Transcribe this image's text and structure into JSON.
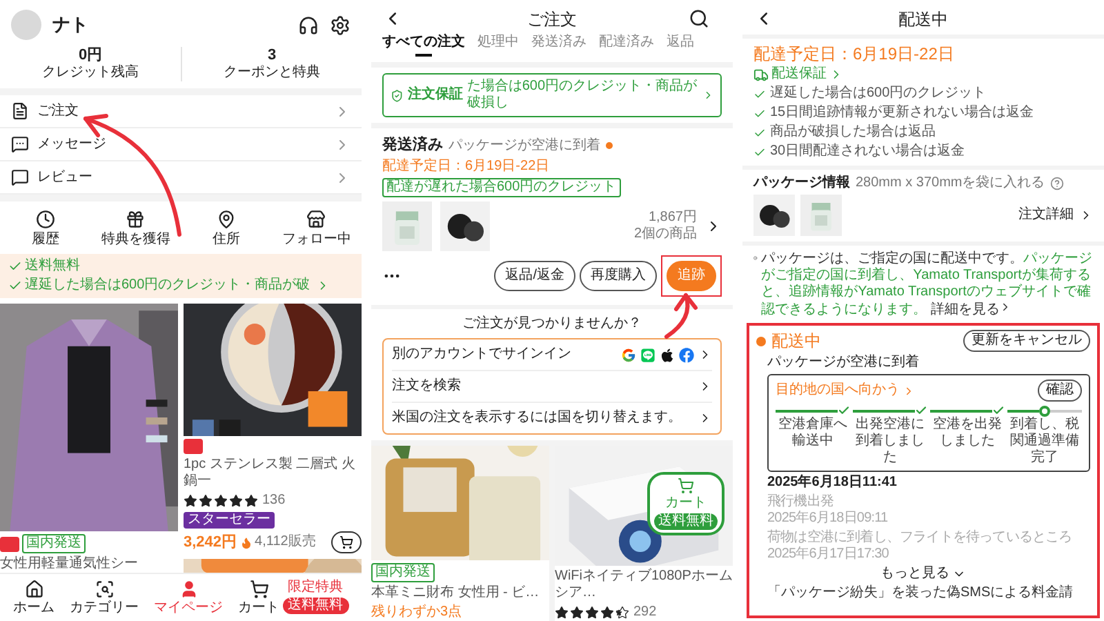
{
  "my_page": {
    "user": {
      "name": "ナト"
    },
    "annotation_arrow": true,
    "stats": [
      {
        "value": "0円",
        "label": "クレジット残高"
      },
      {
        "value": "3",
        "label": "クーポンと特典"
      }
    ],
    "menu": [
      {
        "kind": "orders",
        "label": "ご注文"
      },
      {
        "kind": "messages",
        "label": "メッセージ"
      },
      {
        "kind": "reviews",
        "label": "レビュー"
      }
    ],
    "shortcuts": [
      {
        "kind": "history",
        "label": "履歴"
      },
      {
        "kind": "rewards",
        "label": "特典を獲得"
      },
      {
        "kind": "address",
        "label": "住所"
      },
      {
        "kind": "following",
        "label": "フォロー中"
      }
    ],
    "banner": [
      "送料無料",
      "遅延した場合は600円のクレジット・商品が破"
    ],
    "product_columns": [
      [
        {
          "sale": true,
          "tags": [
            "国内発送"
          ],
          "title": "女性用軽量通気性シー"
        }
      ],
      [
        {
          "sale": true,
          "title": "1pc ステンレス製 二層式 火鍋一",
          "stars": 5,
          "reviews": "136",
          "badge": "スターセラー",
          "price": "3,242円",
          "sold": "4,112販売"
        },
        {
          "kind": "picture"
        }
      ]
    ],
    "nav": [
      {
        "kind": "home",
        "label": "ホーム",
        "selected": false
      },
      {
        "kind": "category",
        "label": "カテゴリー",
        "selected": false
      },
      {
        "kind": "account",
        "label": "マイページ",
        "selected": true
      },
      {
        "kind": "cart",
        "label": "カート",
        "selected": false,
        "badges": [
          {
            "kind": "text",
            "label": "限定特典"
          },
          {
            "kind": "pill",
            "label": "送料無料"
          }
        ]
      }
    ]
  },
  "orders_page": {
    "title": "ご注文",
    "annotation_arrow": true,
    "tabs": [
      {
        "label": "すべての注文",
        "selected": true
      },
      {
        "label": "処理中",
        "selected": false
      },
      {
        "label": "発送済み",
        "selected": false
      },
      {
        "label": "配達済み",
        "selected": false
      },
      {
        "label": "返品",
        "selected": false
      }
    ],
    "guarantee": {
      "label": "注文保証",
      "text": "た場合は600円のクレジット・商品が破損し"
    },
    "order": {
      "status": "発送済み",
      "detail": "パッケージが空港に到着",
      "delivery": "配達予定日：6月19日-22日",
      "tag": "配達が遅れた場合600円のクレジット",
      "total": "1,867円",
      "count": "2個の商品",
      "actions": [
        {
          "kind": "outline",
          "label": "返品/返金",
          "highlighted": false
        },
        {
          "kind": "outline",
          "label": "再度購入",
          "highlighted": false
        },
        {
          "kind": "primary",
          "label": "追跡",
          "highlighted": true
        }
      ]
    },
    "help": {
      "title": "ご注文が見つかりませんか？",
      "links": [
        {
          "kind": "sign_in",
          "label": "別のアカウントでサインイン"
        },
        {
          "kind": "plain",
          "label": "注文を検索"
        },
        {
          "kind": "plain",
          "label": "米国の注文を表示するには国を切り替えます。"
        }
      ]
    },
    "products": [
      {
        "tags": [
          "国内発送"
        ],
        "title": "本革ミニ財布 女性用 - ビ…",
        "note": "残りわずか3点"
      },
      {
        "title": "WiFiネイティブ1080Pホームシア…",
        "stars": 4.5,
        "reviews": "292",
        "cart_badge": {
          "label": "カート",
          "sub": "送料無料"
        }
      }
    ]
  },
  "tracking_page": {
    "title": "配送中",
    "delivery": "配達予定日：6月19日-22日",
    "guarantee": "配送保証",
    "promises": [
      "遅延した場合は600円のクレジット",
      "15日間追跡情報が更新されない場合は返金",
      "商品が破損した場合は返品",
      "30日間配達されない場合は返金"
    ],
    "package": {
      "label": "パッケージ情報",
      "size": "280mm x 370mmを袋に入れる",
      "details": "注文詳細"
    },
    "notice": {
      "parts": [
        {
          "kind": "plain",
          "text": "パッケージは、ご指定の国に配送中です。"
        },
        {
          "kind": "highlight",
          "text": "パッケージがご指定の国に到着し、Yamato Transportが集荷すると、追跡情報がYamato Transportのウェブサイトで確認できるようになります。"
        }
      ],
      "link": "詳細を見る"
    },
    "timeline": {
      "highlighted": true,
      "status": "配送中",
      "cancel": "更新をキャンセル",
      "latest": "パッケージが空港に到着",
      "stage": {
        "title": "目的地の国へ向かう",
        "confirm": "確認",
        "steps": [
          {
            "label": "空港倉庫へ輸送中",
            "done": true
          },
          {
            "label": "出発空港に到着しました",
            "done": true
          },
          {
            "label": "空港を出発しました",
            "done": true
          },
          {
            "label": "到着し、税関通過準備完了",
            "done": false
          }
        ]
      },
      "latest_time": "2025年6月18日11:41",
      "events": [
        {
          "label": "飛行機出発",
          "time": "2025年6月18日09:11"
        },
        {
          "label": "荷物は空港に到着し、フライトを待っているところ",
          "time": "2025年6月17日17:30"
        }
      ],
      "more": "もっと見る",
      "alert": "「パッケージ紛失」を装った偽SMSによる料金請"
    }
  }
}
